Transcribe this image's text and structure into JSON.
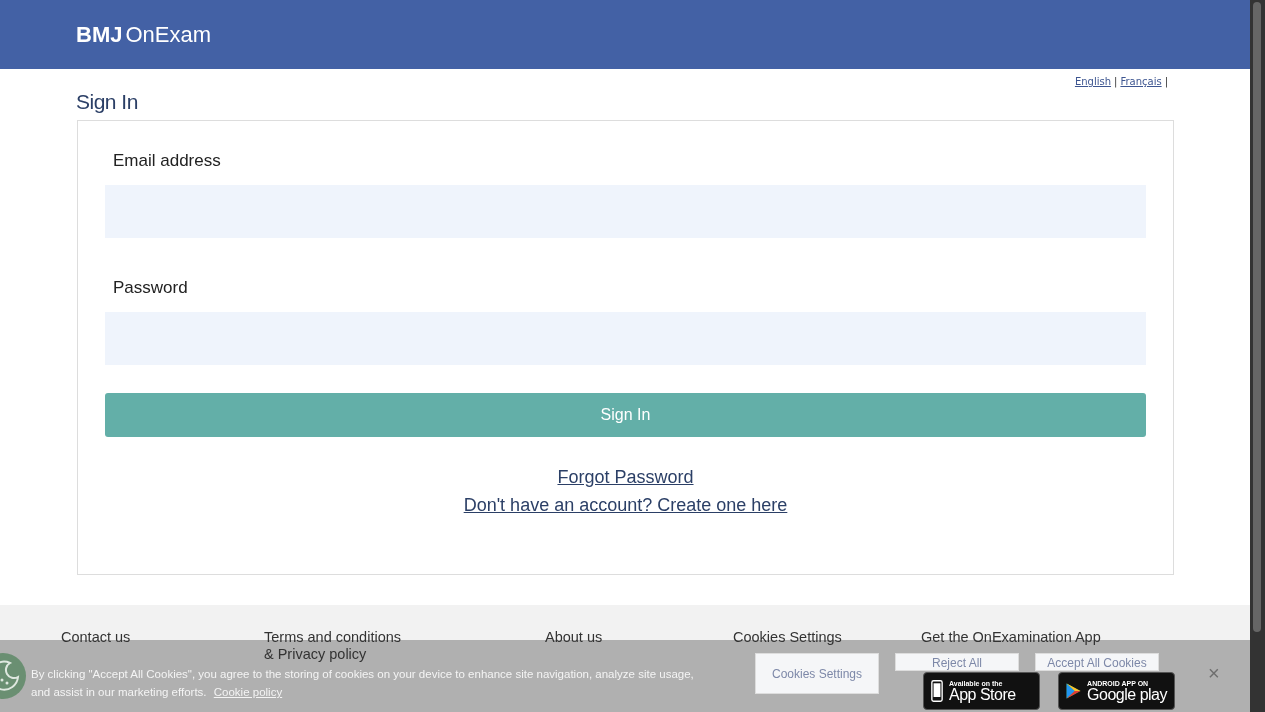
{
  "header": {
    "logo_bold": "BMJ",
    "logo_text": "OnExam"
  },
  "languages": [
    {
      "label": "English",
      "separator": "|"
    },
    {
      "label": "Français",
      "separator": "|"
    }
  ],
  "page_title": "Sign In",
  "form": {
    "fields": [
      {
        "label": "Email address"
      },
      {
        "label": "Password"
      }
    ],
    "submit": "Sign In",
    "links": [
      "Forgot Password",
      "Don't have an account? Create one here"
    ]
  },
  "footer": {
    "links": [
      {
        "lines": [
          "Contact us"
        ]
      },
      {
        "lines": [
          "Terms and conditions",
          "& Privacy policy"
        ]
      },
      {
        "lines": [
          "About us"
        ]
      },
      {
        "lines": [
          "Cookies Settings"
        ]
      }
    ],
    "app_heading": "Get the OnExamination App",
    "badges": [
      {
        "kind": "apple",
        "small": "Available on the",
        "big": "App Store"
      },
      {
        "kind": "android",
        "small": "ANDROID APP ON",
        "big": "Google play"
      }
    ]
  },
  "cookie_banner": {
    "text": "By clicking \"Accept All Cookies\", you agree to the storing of cookies on your device to enhance site navigation, analyze site usage, and assist in our marketing efforts.",
    "policy_link": "Cookie policy",
    "buttons": [
      "Cookies Settings",
      "Reject All",
      "Accept All Cookies"
    ],
    "close": "×"
  }
}
